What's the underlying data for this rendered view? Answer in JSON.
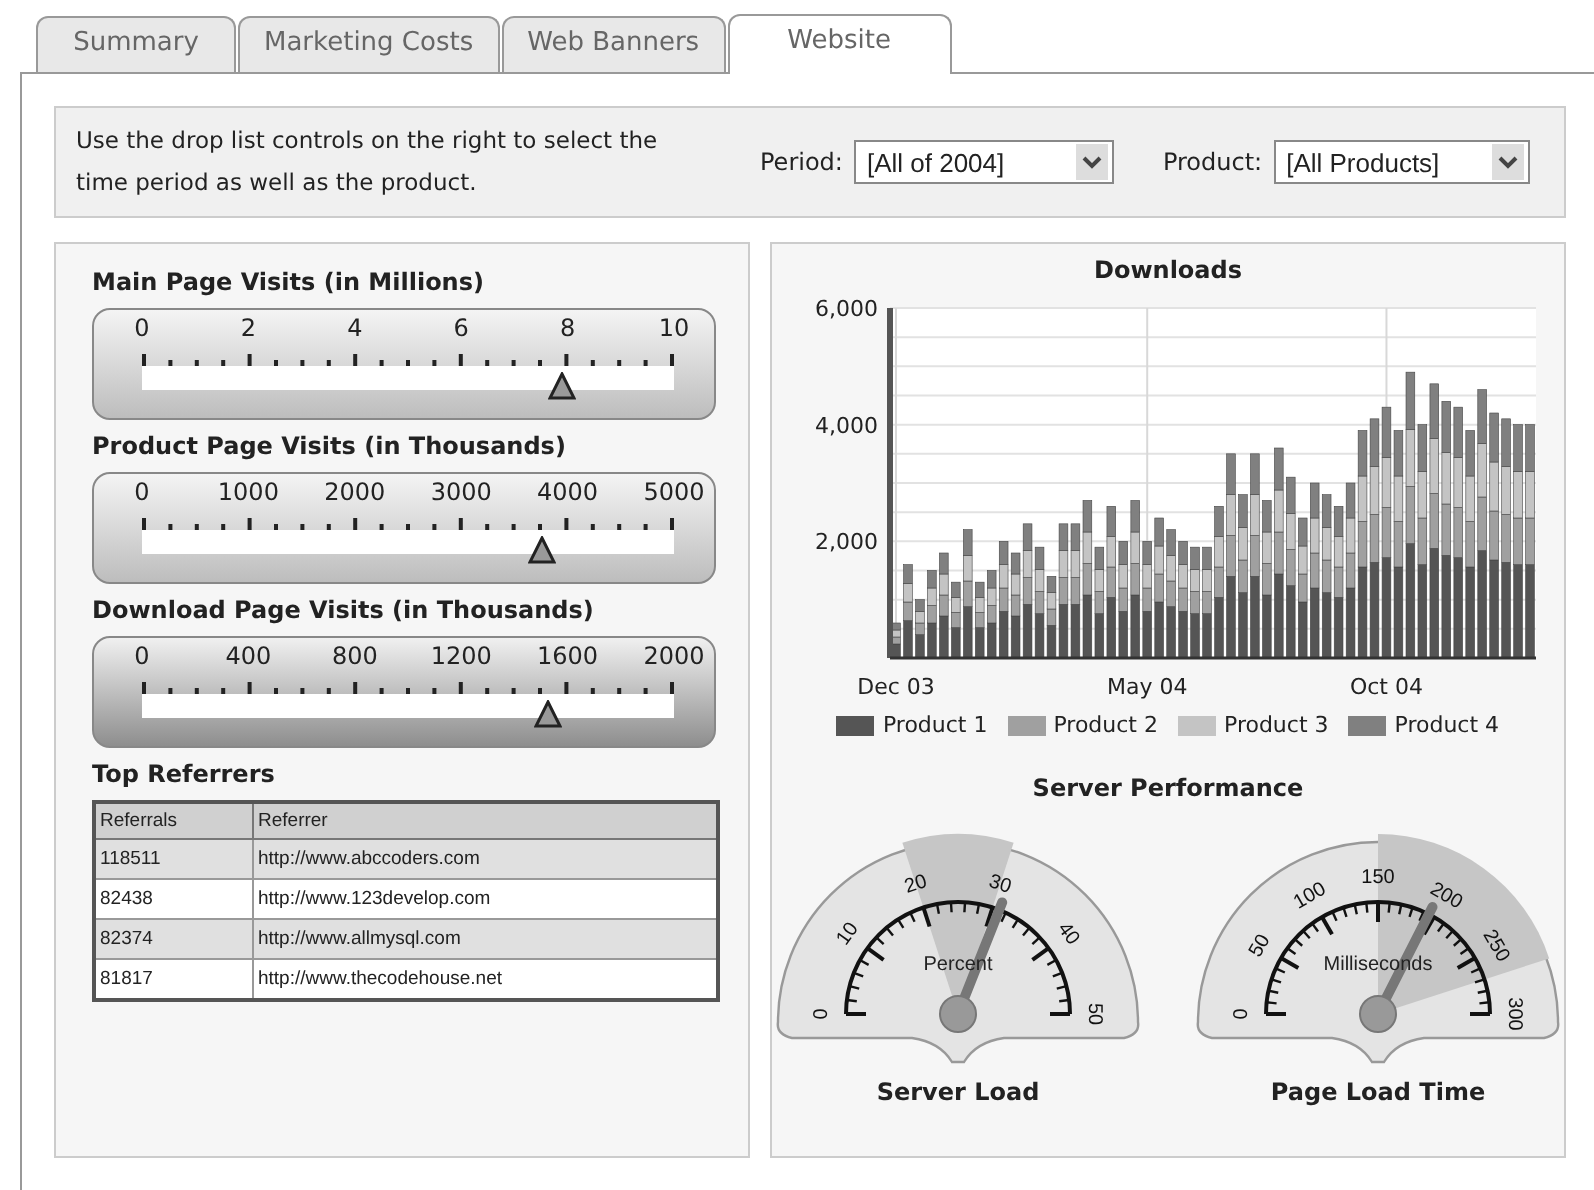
{
  "tabs": [
    {
      "label": "Summary",
      "selected": false
    },
    {
      "label": "Marketing Costs",
      "selected": false
    },
    {
      "label": "Web Banners",
      "selected": false
    },
    {
      "label": "Website",
      "selected": true
    }
  ],
  "filter_bar": {
    "instructions": "Use the drop list controls on the right to select the time period as well as the product.",
    "filters": [
      {
        "label": "Period:",
        "value": "[All of 2004]"
      },
      {
        "label": "Product:",
        "value": "[All Products]"
      }
    ]
  },
  "sliders": [
    {
      "title": "Main Page Visits (in Millions)",
      "scale": [
        "0",
        "2",
        "4",
        "6",
        "8",
        "10"
      ],
      "level": 0.79
    },
    {
      "title": "Product Page Visits (in Thousands)",
      "scale": [
        "0",
        "1000",
        "2000",
        "3000",
        "4000",
        "5000"
      ],
      "level": 0.75
    },
    {
      "title": "Download Page Visits (in Thousands)",
      "scale": [
        "0",
        "400",
        "800",
        "1200",
        "1600",
        "2000"
      ],
      "level": 0.765
    }
  ],
  "referrers": {
    "title": "Top Referrers",
    "columns": [
      "Referrals",
      "Referrer"
    ],
    "rows": [
      [
        "118511",
        "http://www.abccoders.com"
      ],
      [
        "82438",
        "http://www.123develop.com"
      ],
      [
        "82374",
        "http://www.allmysql.com"
      ],
      [
        "81817",
        "http://www.thecodehouse.net"
      ]
    ]
  },
  "downloads": {
    "chart_data": {
      "type": "bar",
      "title": "Downloads",
      "stacked": true,
      "ylim": [
        0,
        6000
      ],
      "yticks": [
        {
          "value": 2000,
          "label": "2,000"
        },
        {
          "value": 4000,
          "label": "4,000"
        },
        {
          "value": 6000,
          "label": "6,000"
        }
      ],
      "grid": true,
      "categories": [
        "Dec 03",
        null,
        null,
        null,
        null,
        null,
        null,
        null,
        null,
        null,
        null,
        null,
        null,
        null,
        null,
        null,
        null,
        null,
        null,
        null,
        null,
        "May 04",
        null,
        null,
        null,
        null,
        null,
        null,
        null,
        null,
        null,
        null,
        null,
        null,
        null,
        null,
        null,
        null,
        null,
        null,
        null,
        "Oct 04",
        null,
        null,
        null,
        null,
        null,
        null,
        null,
        null,
        null,
        null,
        null,
        null
      ],
      "series": [
        {
          "name": "Product 1",
          "color": "#555555",
          "values": [
            240,
            640,
            400,
            600,
            720,
            520,
            880,
            520,
            600,
            800,
            720,
            920,
            760,
            560,
            920,
            920,
            1080,
            760,
            1040,
            800,
            1080,
            800,
            960,
            880,
            800,
            760,
            760,
            1040,
            1400,
            1120,
            1400,
            1080,
            1440,
            1240,
            960,
            1200,
            1120,
            1040,
            1200,
            1560,
            1640,
            1720,
            1560,
            1960,
            1600,
            1880,
            1760,
            1720,
            1560,
            1840,
            1680,
            1640,
            1600,
            1600
          ]
        },
        {
          "name": "Product 2",
          "color": "#a0a0a0",
          "values": [
            120,
            320,
            200,
            300,
            360,
            260,
            440,
            260,
            300,
            400,
            360,
            460,
            380,
            280,
            460,
            460,
            540,
            380,
            520,
            400,
            540,
            400,
            480,
            440,
            400,
            380,
            380,
            520,
            700,
            560,
            700,
            540,
            720,
            620,
            480,
            600,
            560,
            520,
            600,
            780,
            820,
            860,
            780,
            980,
            800,
            940,
            880,
            860,
            780,
            920,
            840,
            820,
            800,
            800
          ]
        },
        {
          "name": "Product 3",
          "color": "#c4c4c4",
          "values": [
            120,
            320,
            200,
            300,
            360,
            260,
            440,
            260,
            300,
            400,
            360,
            460,
            380,
            280,
            460,
            460,
            540,
            380,
            520,
            400,
            540,
            400,
            480,
            440,
            400,
            380,
            380,
            520,
            700,
            560,
            700,
            540,
            720,
            620,
            480,
            600,
            560,
            520,
            600,
            780,
            820,
            860,
            780,
            980,
            800,
            940,
            880,
            860,
            780,
            920,
            840,
            820,
            800,
            800
          ]
        },
        {
          "name": "Product 4",
          "color": "#808080",
          "values": [
            120,
            320,
            200,
            300,
            360,
            260,
            440,
            260,
            300,
            400,
            360,
            460,
            380,
            280,
            460,
            460,
            540,
            380,
            520,
            400,
            540,
            400,
            480,
            440,
            400,
            380,
            380,
            520,
            700,
            560,
            700,
            540,
            720,
            620,
            480,
            600,
            560,
            520,
            600,
            780,
            820,
            860,
            780,
            980,
            800,
            940,
            880,
            860,
            780,
            920,
            840,
            820,
            800,
            800
          ]
        }
      ]
    }
  },
  "performance": {
    "title": "Server Performance",
    "gauges": [
      {
        "unit": "Percent",
        "scale": [
          "0",
          "10",
          "20",
          "30",
          "40",
          "50"
        ],
        "label": "Server Load"
      },
      {
        "unit": "Milliseconds",
        "scale": [
          "0",
          "50",
          "100",
          "150",
          "200",
          "250",
          "300"
        ],
        "label": "Page Load Time"
      }
    ]
  }
}
